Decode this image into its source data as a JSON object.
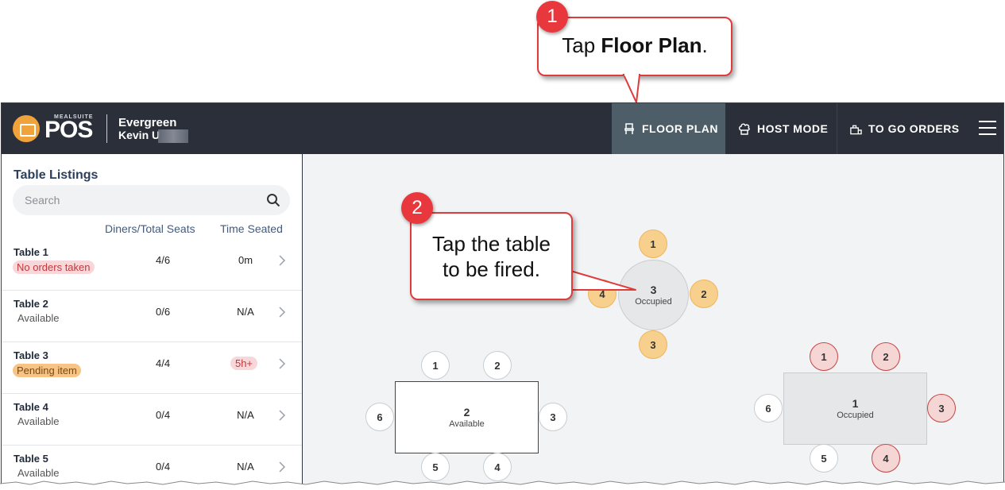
{
  "header": {
    "logo_sub": "MEALSUITE",
    "logo_text": "POS",
    "facility": "Evergreen",
    "user": "Kevin U"
  },
  "nav": {
    "floor_plan": "FLOOR PLAN",
    "host_mode": "HOST MODE",
    "to_go_orders": "TO GO ORDERS"
  },
  "sidebar": {
    "title": "Table Listings",
    "search_placeholder": "Search",
    "col_diners": "Diners/Total Seats",
    "col_time": "Time Seated",
    "rows": [
      {
        "name": "Table 1",
        "status": "No orders taken",
        "diners": "4/6",
        "time": "0m"
      },
      {
        "name": "Table 2",
        "status": "Available",
        "diners": "0/6",
        "time": "N/A"
      },
      {
        "name": "Table 3",
        "status": "Pending item",
        "diners": "4/4",
        "time": "5h+"
      },
      {
        "name": "Table 4",
        "status": "Available",
        "diners": "0/4",
        "time": "N/A"
      },
      {
        "name": "Table 5",
        "status": "Available",
        "diners": "0/4",
        "time": "N/A"
      }
    ]
  },
  "floor": {
    "table3": {
      "number": "3",
      "status": "Occupied",
      "seats": [
        "1",
        "2",
        "3",
        "4"
      ]
    },
    "table2": {
      "number": "2",
      "status": "Available",
      "seats": [
        "1",
        "2",
        "3",
        "4",
        "5",
        "6"
      ]
    },
    "table1": {
      "number": "1",
      "status": "Occupied",
      "seats": [
        "1",
        "2",
        "3",
        "4",
        "5",
        "6"
      ]
    }
  },
  "callouts": {
    "step1_number": "1",
    "step1_text_pre": "Tap ",
    "step1_text_bold": "Floor Plan",
    "step1_text_post": ".",
    "step2_number": "2",
    "step2_line1": "Tap the table",
    "step2_line2": "to be fired."
  },
  "colors": {
    "topbar": "#2a2f3a",
    "active_nav": "#4d5e69",
    "callout_red": "#e03b3b",
    "seat_occupied_orange": "#f8d08e",
    "seat_occupied_red": "#f6d5d5"
  }
}
